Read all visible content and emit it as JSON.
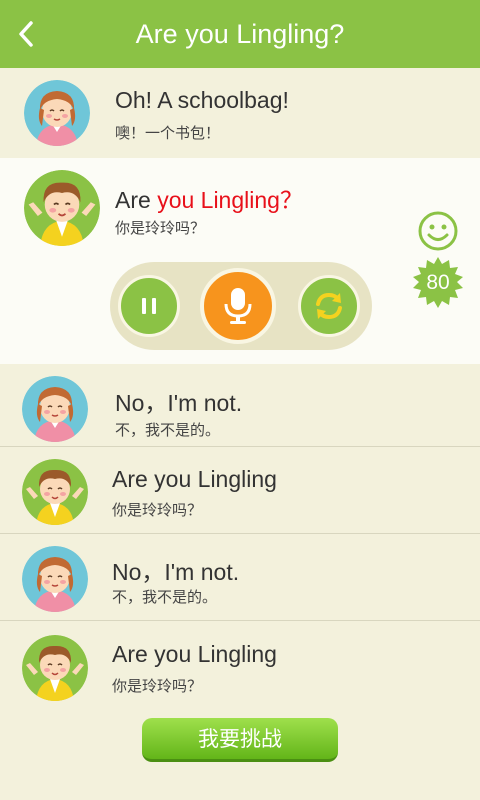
{
  "header": {
    "title": "Are you Lingling?",
    "back_icon": "chevron-left-icon"
  },
  "dialog": [
    {
      "speaker": "girl",
      "english": "Oh! A schoolbag!",
      "chinese": "噢！一个书包！"
    },
    {
      "speaker": "boy",
      "english_prefix": "Are ",
      "english_highlight": "you Lingling？",
      "chinese": "你是玲玲吗？",
      "active": true
    },
    {
      "speaker": "girl",
      "english": "No，I'm not.",
      "chinese": "不，我不是的。"
    },
    {
      "speaker": "boy",
      "english": "Are you Lingling",
      "chinese": "你是玲玲吗？"
    },
    {
      "speaker": "girl",
      "english": "No，I'm not.",
      "chinese": "不，我不是的。"
    },
    {
      "speaker": "boy",
      "english": "Are you Lingling",
      "chinese": "你是玲玲吗？"
    }
  ],
  "score": {
    "icon": "smiley-face-icon",
    "value": "80"
  },
  "controls": {
    "pause_icon": "pause-icon",
    "record_icon": "microphone-icon",
    "replay_icon": "refresh-icon"
  },
  "challenge_button": "我要挑战",
  "colors": {
    "header": "#8bc245",
    "background": "#f3f1dc",
    "highlight": "#e8101a",
    "score_badge": "#8bc245",
    "record": "#f7941d"
  }
}
